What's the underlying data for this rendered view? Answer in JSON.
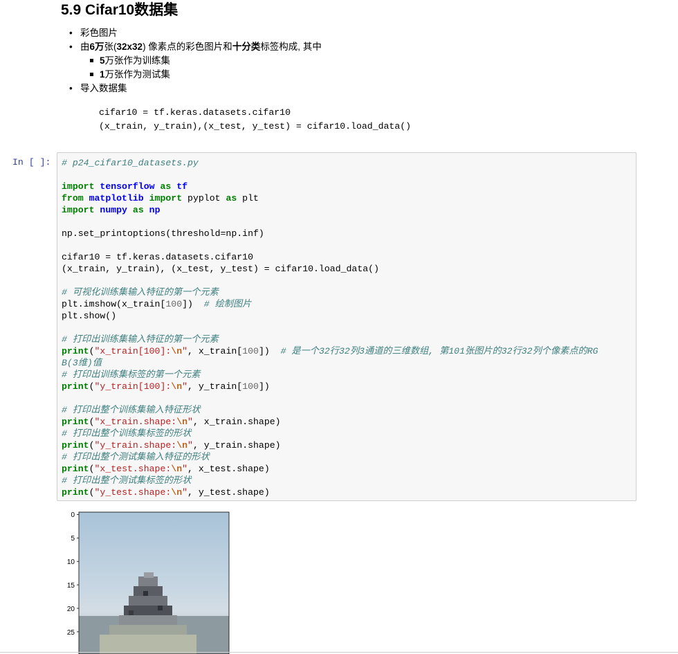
{
  "markdown": {
    "heading": "5.9 Cifar10数据集",
    "bullets": {
      "b1": "彩色图片",
      "b2_pre": "由",
      "b2_bold1": "6万",
      "b2_mid1": "张(",
      "b2_bold2": "32x32",
      "b2_mid2": ") 像素点的彩色图片和",
      "b2_bold3": "十分类",
      "b2_post": "标签构成, 其中",
      "sub1_bold": "5",
      "sub1_text": "万张作为训练集",
      "sub2_bold": "1",
      "sub2_text": "万张作为测试集",
      "b3": "导入数据集"
    },
    "code_line1": "cifar10 = tf.keras.datasets.cifar10",
    "code_line2": "(x_train, y_train),(x_test, y_test) = cifar10.load_data()"
  },
  "cell": {
    "prompt": "In [ ]:",
    "t": {
      "c1": "# p24_cifar10_datasets.py",
      "import": "import",
      "from": "from",
      "as": "as",
      "tensorflow": "tensorflow",
      "tf": "tf",
      "matplotlib": "matplotlib",
      "pyplot": " pyplot ",
      "plt": " plt",
      "numpy": "numpy",
      "np": "np",
      "line_printopt": "np.set_printoptions(threshold=np.inf)",
      "line_cifar": "cifar10 = tf.keras.datasets.cifar10",
      "line_load": "(x_train, y_train), (x_test, y_test) = cifar10.load_data()",
      "c2": "# 可视化训练集输入特征的第一个元素",
      "imshow_a": "plt.imshow(x_train[",
      "n100": "100",
      "imshow_b": "])  ",
      "c3": "# 绘制图片",
      "show": "plt.show()",
      "c4": "# 打印出训练集输入特征的第一个元素",
      "print": "print",
      "paren": "(",
      "s1": "\"x_train[100]:",
      "nl": "\\n",
      "q": "\"",
      "p1_b": ", x_train[",
      "p1_c": "])  ",
      "c5a": "# 是一个32行32列3通道的三维数组, 第101张图片的32行32列个像素点的RG",
      "c5b": "B(3维)值",
      "c6": "# 打印出训练集标签的第一个元素",
      "s2": "\"y_train[100]:",
      "p2_b": ", y_train[",
      "p2_c": "])",
      "c7": "# 打印出整个训练集输入特征形状",
      "s3": "\"x_train.shape:",
      "p3_b": ", x_train.shape)",
      "c8": "# 打印出整个训练集标签的形状",
      "s4": "\"y_train.shape:",
      "p4_b": ", y_train.shape)",
      "c9": "# 打印出整个测试集输入特征的形状",
      "s5": "\"x_test.shape:",
      "p5_b": ", x_test.shape)",
      "c10": "# 打印出整个测试集标签的形状",
      "s6": "\"y_test.shape:",
      "p6_b": ", y_test.shape)"
    }
  },
  "output": {
    "y_ticks": [
      "0",
      "5",
      "10",
      "15",
      "20",
      "25"
    ]
  }
}
